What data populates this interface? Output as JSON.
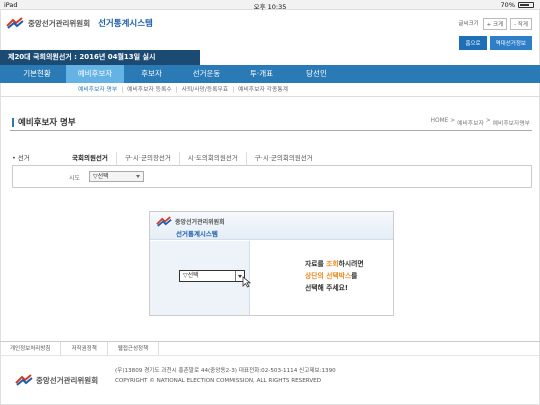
{
  "status_bar": {
    "device": "iPad",
    "time": "오후 10:35",
    "battery": "70%"
  },
  "header": {
    "org_name": "중앙선거관리위원회",
    "system_name": "선거통계시스템",
    "util_links": [
      "글씨크기",
      "+ 크게",
      "- 작게"
    ],
    "quick_buttons": [
      "홈으로",
      "역대선거정보"
    ],
    "election_banner": "제20대 국회의원선거 : 2016년 04월13일 실시"
  },
  "nav": {
    "items": [
      "기본현황",
      "예비후보자",
      "후보자",
      "선거운동",
      "투·개표",
      "당선인"
    ],
    "active_index": 1
  },
  "sub_nav": {
    "items": [
      "예비후보자 명부",
      "예비후보자 등록수",
      "사퇴/사망/등록무효",
      "예비후보자 각종통계"
    ]
  },
  "page": {
    "title": "예비후보자 명부",
    "breadcrumb": [
      "HOME",
      "예비후보자",
      "예비후보자명부"
    ]
  },
  "election_tabs": {
    "label": "• 선거",
    "items": [
      "국회의원선거",
      "구·시·군의장선거",
      "시·도의회의원선거",
      "구·시·군의회의원선거"
    ]
  },
  "filter": {
    "label": "시도",
    "value": "▽선택"
  },
  "notice": {
    "org_name": "중앙선거관리위원회",
    "system_name": "선거통계시스템",
    "select_value": "▽선택",
    "line1_a": "자료를 ",
    "line1_b": "조회",
    "line1_c": "하시려면",
    "line2_a": "상단의 선택박스",
    "line2_b": "를",
    "line3": "선택해 주세요!"
  },
  "footer": {
    "links": [
      "개인정보처리방침",
      "저작권정책",
      "웹접근성정책"
    ],
    "org_name": "중앙선거관리위원회",
    "address": "(우)13809 경기도 과천시 홍촌말로 44(중앙동2-3) 대표전화:02-503-1114 신고제보:1390",
    "copyright": "COPYRIGHT © NATIONAL ELECTION COMMISSION, ALL RIGHTS RESERVED"
  },
  "colors": {
    "nav": "#2a7ab6",
    "nav_active": "#65b3e5",
    "banner": "#1b4a73",
    "highlight": "#e98b21"
  },
  "icons": [
    "nec-logo-icon",
    "chevron-down-icon",
    "mouse-cursor-icon",
    "battery-icon"
  ]
}
